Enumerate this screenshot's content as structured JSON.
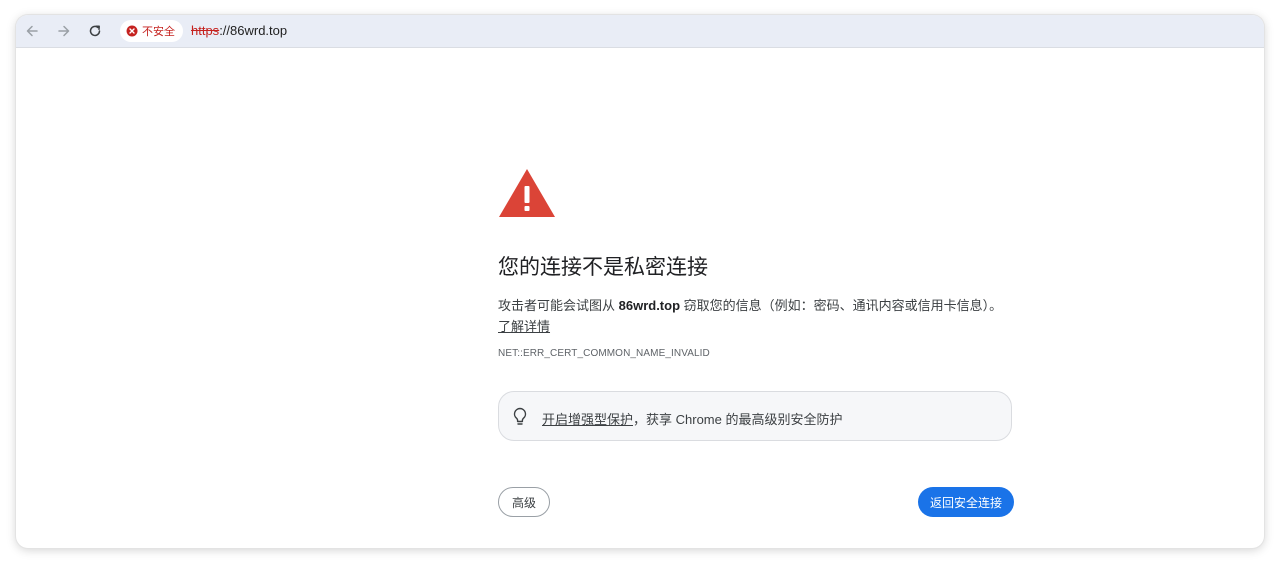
{
  "toolbar": {
    "back_icon": "arrow-left-icon",
    "forward_icon": "arrow-right-icon",
    "reload_icon": "reload-icon",
    "security_chip": {
      "icon": "error-circle-icon",
      "label": "不安全",
      "color": "#c5221f"
    },
    "url": {
      "scheme": "https",
      "rest": "://86wrd.top"
    }
  },
  "interstitial": {
    "icon": "warning-triangle-icon",
    "icon_color": "#db4437",
    "title": "您的连接不是私密连接",
    "description_before": "攻击者可能会试图从 ",
    "host": "86wrd.top",
    "description_after": " 窃取您的信息（例如：密码、通讯内容或信用卡信息）。",
    "learn_more": "了解详情",
    "error_code": "NET::ERR_CERT_COMMON_NAME_INVALID",
    "enhanced": {
      "icon": "lightbulb-icon",
      "link_text": "开启增强型保护",
      "text": "，获享 Chrome 的最高级别安全防护"
    },
    "advanced_button": "高级",
    "back_button": "返回安全连接",
    "primary_color": "#1a73e8"
  }
}
